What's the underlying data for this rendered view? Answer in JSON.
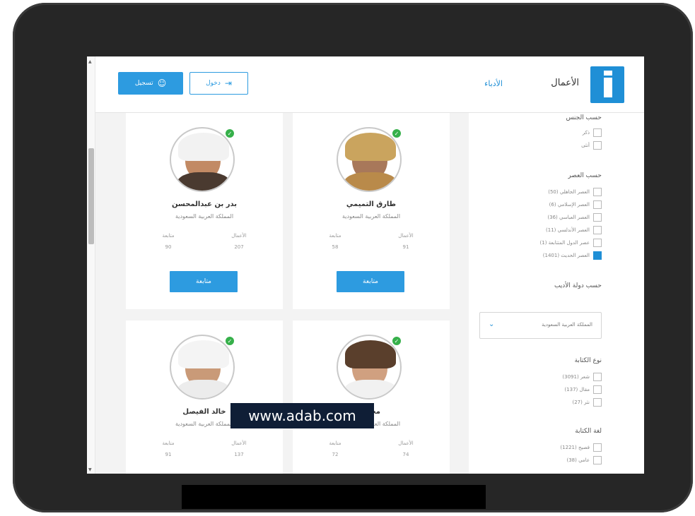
{
  "header": {
    "nav_works": "الأعمال",
    "nav_writers": "الأدباء",
    "login_label": "دخول",
    "register_label": "تسجيل"
  },
  "sidebar": {
    "gender_title": "حسب الجنس",
    "gender_options": [
      {
        "label": "ذكر",
        "checked": false
      },
      {
        "label": "أنثى",
        "checked": false
      }
    ],
    "era_title": "حسب العصر",
    "era_options": [
      {
        "label": "العصر الجاهلي (50)",
        "checked": false
      },
      {
        "label": "العصر الإسلامي (6)",
        "checked": false
      },
      {
        "label": "العصر العباسي (36)",
        "checked": false
      },
      {
        "label": "العصر الأندلسي (11)",
        "checked": false
      },
      {
        "label": "عصر الدول المتتابعة (1)",
        "checked": false
      },
      {
        "label": "العصر الحديث (1401)",
        "checked": true
      }
    ],
    "country_title": "حسب دولة الأديب",
    "country_selected": "المملكة العربية السعودية",
    "writing_type_title": "نوع الكتابة",
    "writing_type_options": [
      {
        "label": "شعر (3091)",
        "checked": false
      },
      {
        "label": "مقال (137)",
        "checked": false
      },
      {
        "label": "نثر (27)",
        "checked": false
      }
    ],
    "language_title": "لغة الكتابة",
    "language_options": [
      {
        "label": "فصيح (1221)",
        "checked": false
      },
      {
        "label": "عامي (38)",
        "checked": false
      }
    ]
  },
  "cards": [
    {
      "name": "طارق التميمي",
      "country": "المملكة العربية السعودية",
      "works_label": "الأعمال",
      "works_value": "91",
      "followers_label": "متابعة",
      "followers_value": "58",
      "action": "متابعة",
      "verified": true
    },
    {
      "name": "بدر بن عبدالمحسن",
      "country": "المملكة العربية السعودية",
      "works_label": "الأعمال",
      "works_value": "207",
      "followers_label": "متابعة",
      "followers_value": "90",
      "action": "متابعة",
      "verified": true
    },
    {
      "name": "محمد",
      "country": "المملكة العربية السعودية",
      "works_label": "الأعمال",
      "works_value": "74",
      "followers_label": "متابعة",
      "followers_value": "72",
      "verified": true
    },
    {
      "name": "خالد الفيصل",
      "country": "المملكة العربية السعودية",
      "works_label": "الأعمال",
      "works_value": "137",
      "followers_label": "متابعة",
      "followers_value": "91",
      "verified": true
    }
  ],
  "watermark": "www.adab.com",
  "colors": {
    "accent": "#2d9be0",
    "logo": "#1f8fd6",
    "verified": "#36b04a",
    "frame": "#262626"
  }
}
